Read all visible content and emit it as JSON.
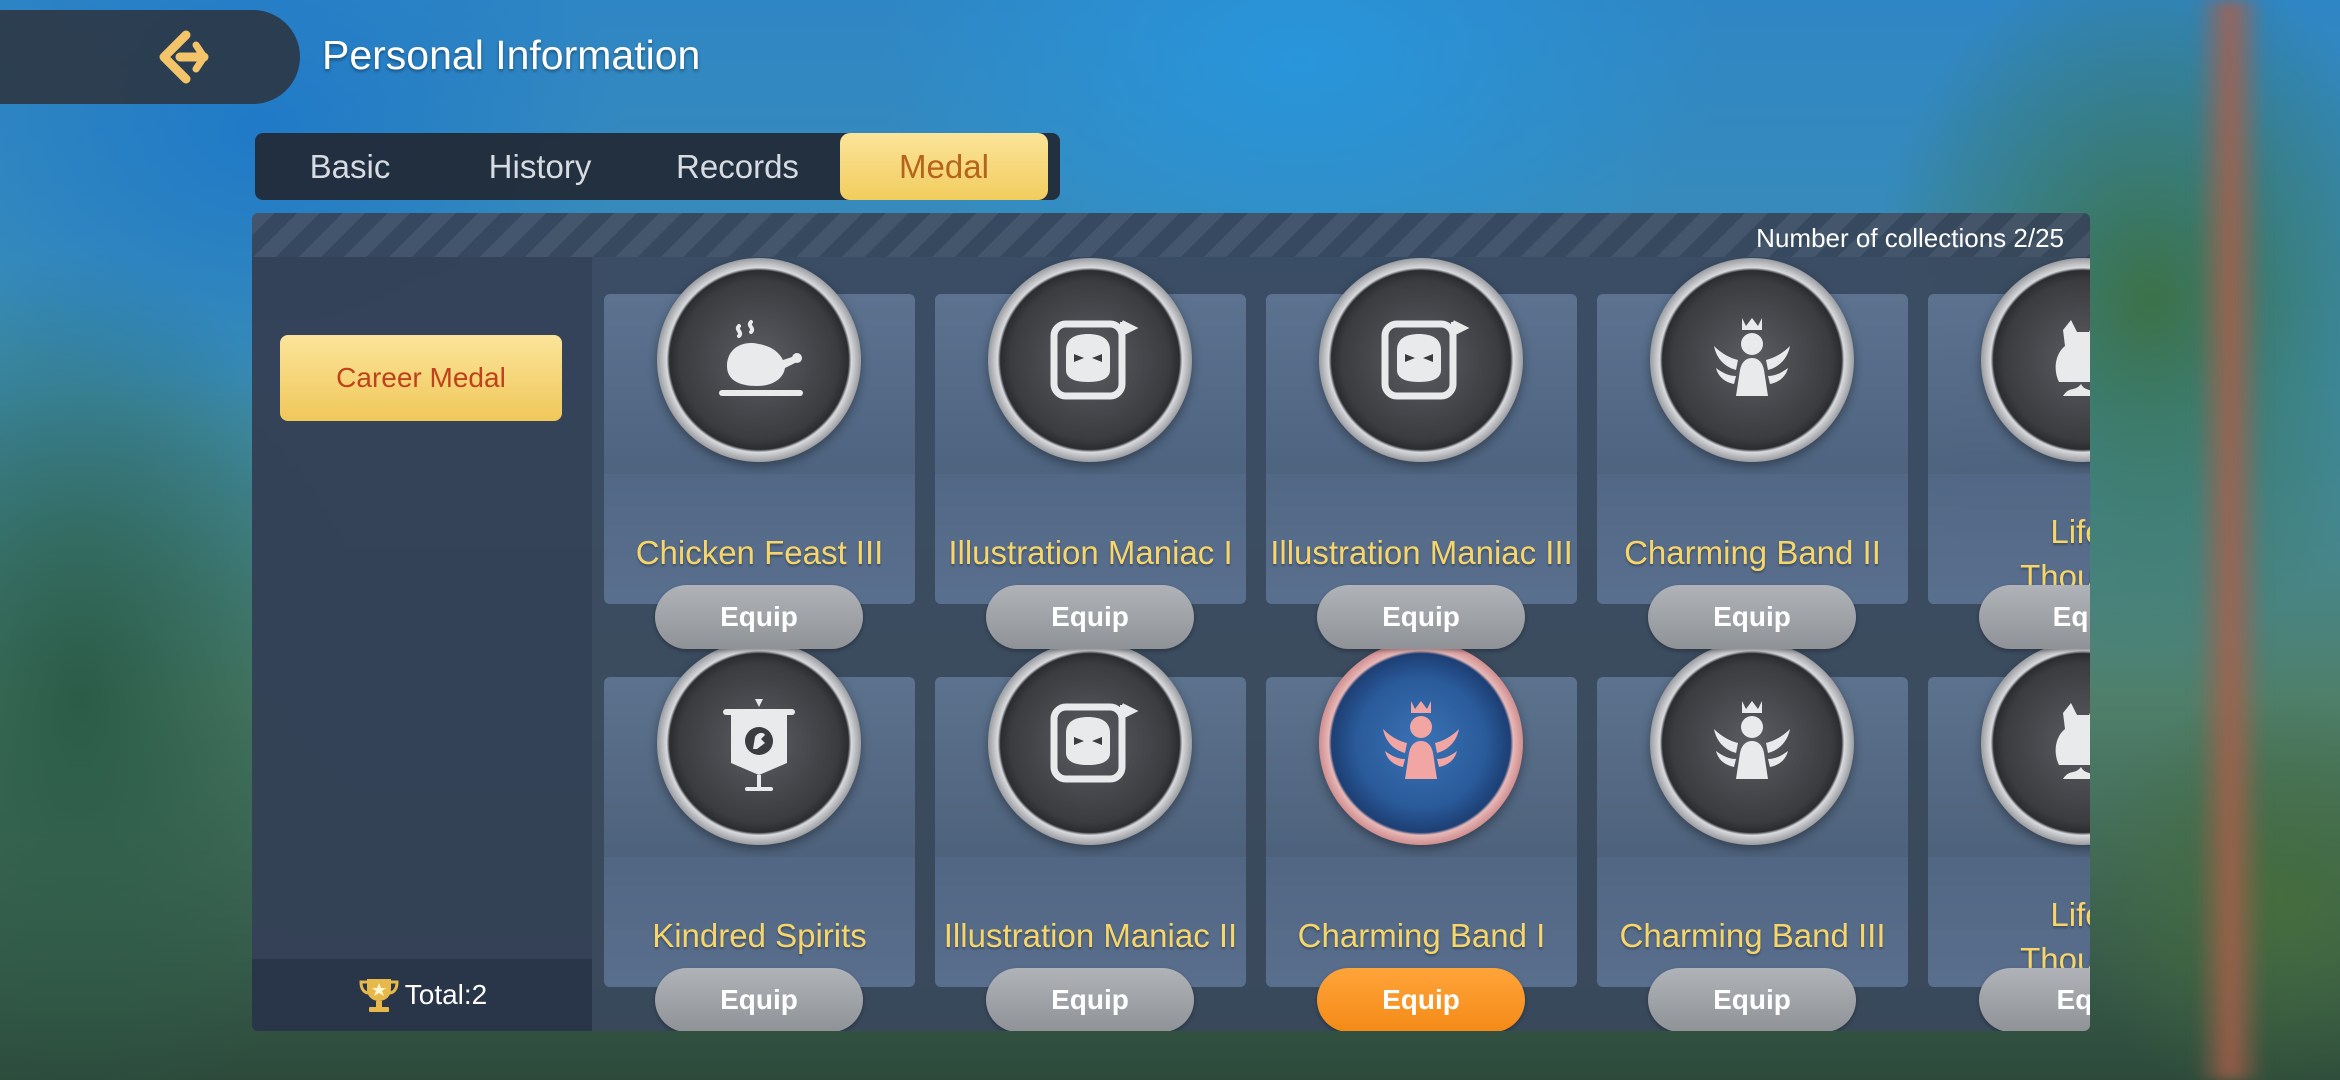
{
  "header": {
    "title": "Personal Information"
  },
  "tabs": [
    {
      "label": "Basic"
    },
    {
      "label": "History"
    },
    {
      "label": "Records"
    },
    {
      "label": "Medal"
    }
  ],
  "panel": {
    "collections": "Number of collections 2/25",
    "category": "Career Medal",
    "total": "Total:2"
  },
  "medals": [
    {
      "name": "Chicken Feast III",
      "icon": "chicken-icon",
      "equip": "Equip"
    },
    {
      "name": "Illustration Maniac I",
      "icon": "mask-icon",
      "equip": "Equip"
    },
    {
      "name": "Illustration Maniac III",
      "icon": "mask-icon",
      "equip": "Equip"
    },
    {
      "name": "Charming Band II",
      "icon": "crown-bust-icon",
      "equip": "Equip"
    },
    {
      "name": "Life w\nThousand",
      "icon": "creature-icon",
      "equip": "Equi"
    },
    {
      "name": "Kindred Spirits",
      "icon": "banner-icon",
      "equip": "Equip"
    },
    {
      "name": "Illustration Maniac II",
      "icon": "mask-icon",
      "equip": "Equip"
    },
    {
      "name": "Charming Band I",
      "icon": "crown-bust-icon",
      "equip": "Equip",
      "active": true
    },
    {
      "name": "Charming Band III",
      "icon": "crown-bust-icon",
      "equip": "Equip"
    },
    {
      "name": "Life w\nThousand",
      "icon": "creature-icon",
      "equip": "Equ"
    }
  ],
  "colors": {
    "accent": "#f6d66b",
    "equipped": "#f48a16",
    "tab_active": "#f2cd5e"
  }
}
